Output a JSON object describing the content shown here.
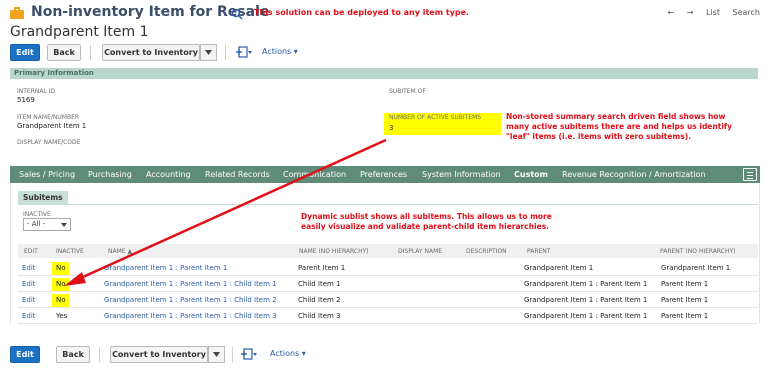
{
  "header": {
    "record_type": "Non-inventory Item for Resale",
    "annotation": "This solution can be deployed to any item type.",
    "nav_back": "←",
    "nav_forward": "→",
    "list_label": "List",
    "search_label": "Search"
  },
  "record_title": "Grandparent Item 1",
  "toolbar": {
    "edit": "Edit",
    "back": "Back",
    "convert": "Convert to Inventory",
    "actions": "Actions ▾"
  },
  "primary": {
    "section_title": "Primary Information",
    "internal_id_label": "INTERNAL ID",
    "internal_id_value": "5169",
    "item_name_label": "ITEM NAME/NUMBER",
    "item_name_value": "Grandparent Item 1",
    "display_name_label": "DISPLAY NAME/CODE",
    "subitem_of_label": "SUBITEM OF",
    "active_subitems_label": "NUMBER OF ACTIVE SUBITEMS",
    "active_subitems_value": "3",
    "annotation_line1": "Non-stored summary search driven field shows how",
    "annotation_line2": "many active subitems there are and helps us identify",
    "annotation_line3": "\"leaf\" items (i.e. items with zero subitems)."
  },
  "tabs": [
    "Sales / Pricing",
    "Purchasing",
    "Accounting",
    "Related Records",
    "Communication",
    "Preferences",
    "System Information",
    "Custom",
    "Revenue Recognition / Amortization"
  ],
  "subitems": {
    "tab_label": "Subitems",
    "filter_label": "INACTIVE",
    "filter_value": "- All -",
    "annotation_line1": "Dynamic sublist shows all subitems. This allows us to more",
    "annotation_line2": "easily visualize and validate parent-child item hierarchies.",
    "columns": [
      "EDIT",
      "INACTIVE",
      "NAME ▲",
      "NAME (NO HIERARCHY)",
      "DISPLAY NAME",
      "DESCRIPTION",
      "PARENT",
      "PARENT (NO HIERARCHY)"
    ],
    "rows": [
      {
        "edit": "Edit",
        "inactive": "No",
        "name": "Grandparent Item 1 : Parent Item 1",
        "name_nh": "Parent Item 1",
        "parent": "Grandparent Item 1",
        "parent_nh": "Grandparent Item 1"
      },
      {
        "edit": "Edit",
        "inactive": "No",
        "name": "Grandparent Item 1 : Parent Item 1 : Child Item 1",
        "name_nh": "Child Item 1",
        "parent": "Grandparent Item 1 : Parent Item 1",
        "parent_nh": "Parent Item 1"
      },
      {
        "edit": "Edit",
        "inactive": "No",
        "name": "Grandparent Item 1 : Parent Item 1 : Child Item 2",
        "name_nh": "Child Item 2",
        "parent": "Grandparent Item 1 : Parent Item 1",
        "parent_nh": "Parent Item 1"
      },
      {
        "edit": "Edit",
        "inactive": "Yes",
        "name": "Grandparent Item 1 : Parent Item 1 : Child Item 3",
        "name_nh": "Child Item 3",
        "parent": "Grandparent Item 1 : Parent Item 1",
        "parent_nh": "Parent Item 1"
      }
    ]
  },
  "colors": {
    "accent": "#1c72c2",
    "tab_bar": "#5f8c78",
    "section_bar": "#b8d6cc",
    "annotation": "#e0101a",
    "highlight": "#ffff00",
    "link": "#2a5da8"
  }
}
